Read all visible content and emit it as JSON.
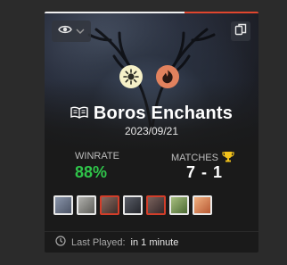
{
  "card": {
    "deck_name": "Boros Enchants",
    "date": "2023/09/21",
    "winrate_label": "WINRATE",
    "winrate_value": "88%",
    "matches_label": "MATCHES",
    "matches_value": "7 - 1",
    "colors": [
      "white",
      "red"
    ],
    "last_played_label": "Last Played:",
    "last_played_value": "in 1 minute",
    "card_thumbs": [
      {
        "name": "card-1",
        "border": "#e8e8e8",
        "color": "#6a7388"
      },
      {
        "name": "card-2",
        "border": "#e8e8e8",
        "color": "#8a8a86"
      },
      {
        "name": "card-3",
        "border": "#d23e2a",
        "color": "#6b5248"
      },
      {
        "name": "card-4",
        "border": "#e8e8e8",
        "color": "#3a3d45"
      },
      {
        "name": "card-5",
        "border": "#d23e2a",
        "color": "#5a4844"
      },
      {
        "name": "card-6",
        "border": "#e8e8e8",
        "color": "#7b9a5a"
      },
      {
        "name": "card-7",
        "border": "#e8e8e8",
        "color": "#d88a5a"
      }
    ],
    "accent_win": "#2fc54a",
    "accent_red": "#e0462e"
  },
  "icons": {
    "visibility": "eye-icon",
    "dropdown": "chevron-down-icon",
    "copy": "copy-icon",
    "deck": "book-icon",
    "trophy": "trophy-icon",
    "clock": "clock-icon"
  }
}
